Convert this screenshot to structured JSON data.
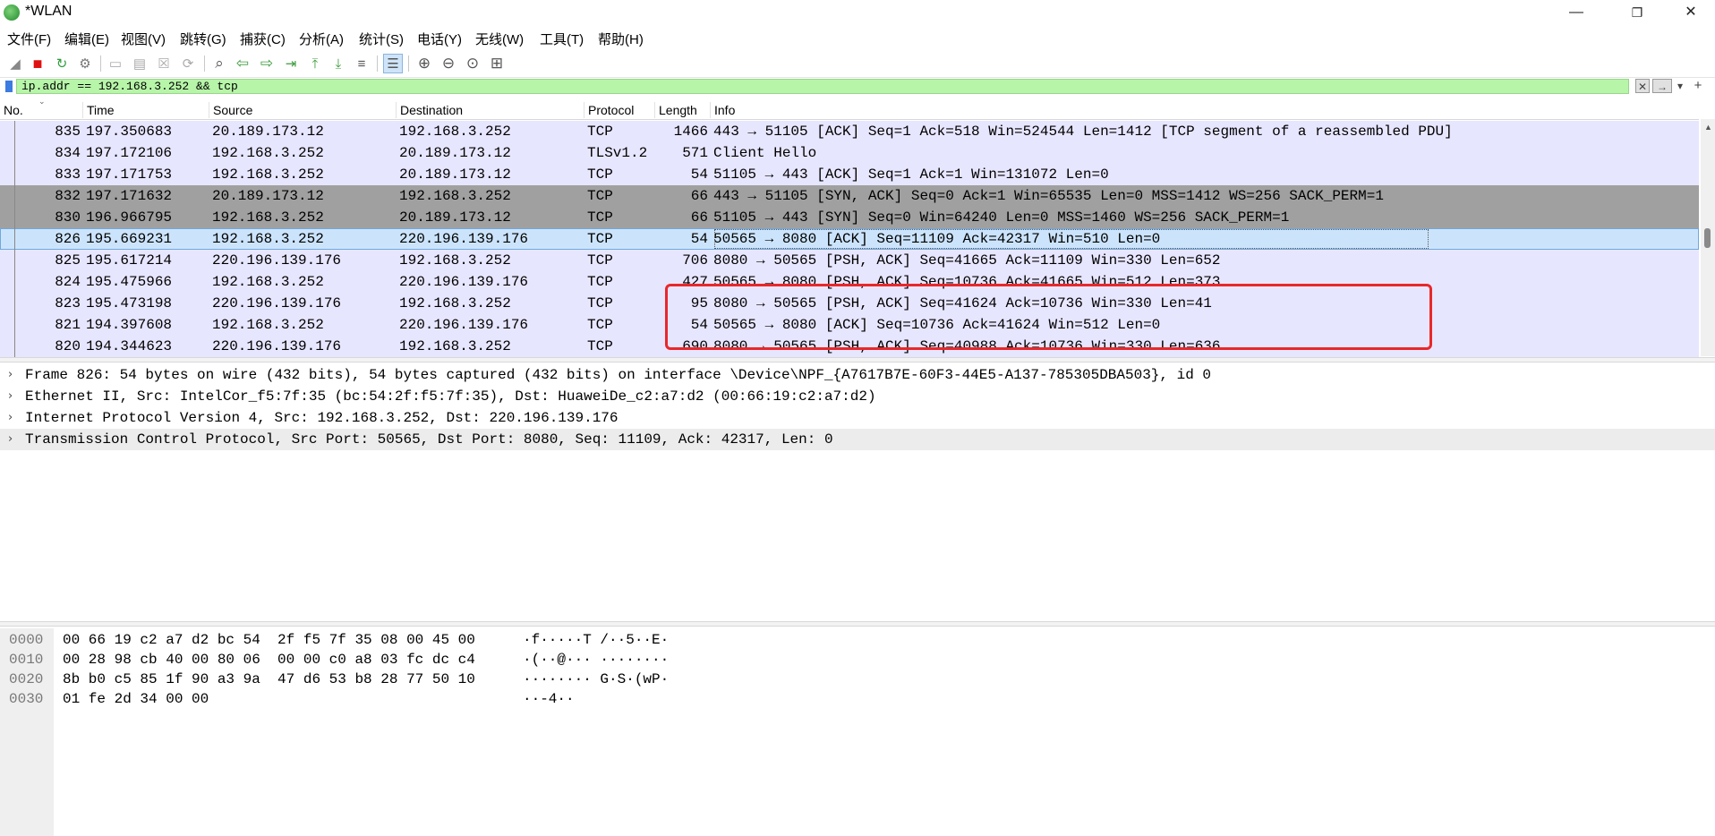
{
  "window": {
    "title": "*WLAN",
    "minimize": "—",
    "restore": "❐",
    "close": "✕"
  },
  "menu": [
    "文件(F)",
    "编辑(E)",
    "视图(V)",
    "跳转(G)",
    "捕获(C)",
    "分析(A)",
    "统计(S)",
    "电话(Y)",
    "无线(W)",
    "工具(T)",
    "帮助(H)"
  ],
  "toolbar": [
    {
      "icon": "shark-fin-start-icon",
      "glyph": "◢"
    },
    {
      "icon": "stop-capture-icon",
      "glyph": "■"
    },
    {
      "icon": "restart-capture-icon",
      "glyph": "↻"
    },
    {
      "icon": "capture-options-icon",
      "glyph": "⚙"
    },
    {
      "icon": "open-file-icon",
      "glyph": "▭"
    },
    {
      "icon": "save-file-icon",
      "glyph": "▤"
    },
    {
      "icon": "close-file-icon",
      "glyph": "☒"
    },
    {
      "icon": "reload-file-icon",
      "glyph": "⟳"
    },
    {
      "icon": "find-packet-icon",
      "glyph": "⌕"
    },
    {
      "icon": "go-back-icon",
      "glyph": "⇦"
    },
    {
      "icon": "go-forward-icon",
      "glyph": "⇨"
    },
    {
      "icon": "go-to-packet-icon",
      "glyph": "⇥"
    },
    {
      "icon": "go-first-icon",
      "glyph": "⤒"
    },
    {
      "icon": "go-last-icon",
      "glyph": "⤓"
    },
    {
      "icon": "auto-scroll-icon",
      "glyph": "≡"
    },
    {
      "icon": "colorize-icon",
      "glyph": "☰"
    },
    {
      "icon": "zoom-in-icon",
      "glyph": "⊕"
    },
    {
      "icon": "zoom-out-icon",
      "glyph": "⊖"
    },
    {
      "icon": "zoom-normal-icon",
      "glyph": "⊙"
    },
    {
      "icon": "resize-columns-icon",
      "glyph": "⊞"
    }
  ],
  "filter": {
    "value": "ip.addr == 192.168.3.252 && tcp",
    "clear_glyph": "✕",
    "apply_glyph": "→",
    "dropdown_glyph": "▾",
    "add_glyph": "+"
  },
  "columns": [
    "No.",
    "Time",
    "Source",
    "Destination",
    "Protocol",
    "Length",
    "Info"
  ],
  "packets": [
    {
      "no": "835",
      "time": "197.350683",
      "src": "20.189.173.12",
      "dst": "192.168.3.252",
      "proto": "TCP",
      "len": "1466",
      "info": "443 → 51105 [ACK] Seq=1 Ack=518 Win=524544 Len=1412 [TCP segment of a reassembled PDU]",
      "style": "normal"
    },
    {
      "no": "834",
      "time": "197.172106",
      "src": "192.168.3.252",
      "dst": "20.189.173.12",
      "proto": "TLSv1.2",
      "len": "571",
      "info": "Client Hello",
      "style": "normal"
    },
    {
      "no": "833",
      "time": "197.171753",
      "src": "192.168.3.252",
      "dst": "20.189.173.12",
      "proto": "TCP",
      "len": "54",
      "info": "51105 → 443 [ACK] Seq=1 Ack=1 Win=131072 Len=0",
      "style": "normal"
    },
    {
      "no": "832",
      "time": "197.171632",
      "src": "20.189.173.12",
      "dst": "192.168.3.252",
      "proto": "TCP",
      "len": "66",
      "info": "443 → 51105 [SYN, ACK] Seq=0 Ack=1 Win=65535 Len=0 MSS=1412 WS=256 SACK_PERM=1",
      "style": "syn"
    },
    {
      "no": "830",
      "time": "196.966795",
      "src": "192.168.3.252",
      "dst": "20.189.173.12",
      "proto": "TCP",
      "len": "66",
      "info": "51105 → 443 [SYN] Seq=0 Win=64240 Len=0 MSS=1460 WS=256 SACK_PERM=1",
      "style": "syn"
    },
    {
      "no": "826",
      "time": "195.669231",
      "src": "192.168.3.252",
      "dst": "220.196.139.176",
      "proto": "TCP",
      "len": "54",
      "info": "50565 → 8080 [ACK] Seq=11109 Ack=42317 Win=510 Len=0",
      "style": "selected"
    },
    {
      "no": "825",
      "time": "195.617214",
      "src": "220.196.139.176",
      "dst": "192.168.3.252",
      "proto": "TCP",
      "len": "706",
      "info": "8080 → 50565 [PSH, ACK] Seq=41665 Ack=11109 Win=330 Len=652",
      "style": "normal"
    },
    {
      "no": "824",
      "time": "195.475966",
      "src": "192.168.3.252",
      "dst": "220.196.139.176",
      "proto": "TCP",
      "len": "427",
      "info": "50565 → 8080 [PSH, ACK] Seq=10736 Ack=41665 Win=512 Len=373",
      "style": "normal"
    },
    {
      "no": "823",
      "time": "195.473198",
      "src": "220.196.139.176",
      "dst": "192.168.3.252",
      "proto": "TCP",
      "len": "95",
      "info": "8080 → 50565 [PSH, ACK] Seq=41624 Ack=10736 Win=330 Len=41",
      "style": "normal"
    },
    {
      "no": "821",
      "time": "194.397608",
      "src": "192.168.3.252",
      "dst": "220.196.139.176",
      "proto": "TCP",
      "len": "54",
      "info": "50565 → 8080 [ACK] Seq=10736 Ack=41624 Win=512 Len=0",
      "style": "normal"
    },
    {
      "no": "820",
      "time": "194.344623",
      "src": "220.196.139.176",
      "dst": "192.168.3.252",
      "proto": "TCP",
      "len": "690",
      "info": "8080 → 50565 [PSH, ACK] Seq=40988 Ack=10736 Win=330 Len=636",
      "style": "normal"
    }
  ],
  "details": [
    "Frame 826: 54 bytes on wire (432 bits), 54 bytes captured (432 bits) on interface \\Device\\NPF_{A7617B7E-60F3-44E5-A137-785305DBA503}, id 0",
    "Ethernet II, Src: IntelCor_f5:7f:35 (bc:54:2f:f5:7f:35), Dst: HuaweiDe_c2:a7:d2 (00:66:19:c2:a7:d2)",
    "Internet Protocol Version 4, Src: 192.168.3.252, Dst: 220.196.139.176",
    "Transmission Control Protocol, Src Port: 50565, Dst Port: 8080, Seq: 11109, Ack: 42317, Len: 0"
  ],
  "bytes": [
    {
      "offset": "0000",
      "hex": "00 66 19 c2 a7 d2 bc 54  2f f5 7f 35 08 00 45 00",
      "ascii": "·f·····T /··5··E·"
    },
    {
      "offset": "0010",
      "hex": "00 28 98 cb 40 00 80 06  00 00 c0 a8 03 fc dc c4",
      "ascii": "·(··@··· ········"
    },
    {
      "offset": "0020",
      "hex": "8b b0 c5 85 1f 90 a3 9a  47 d6 53 b8 28 77 50 10",
      "ascii": "········ G·S·(wP·"
    },
    {
      "offset": "0030",
      "hex": "01 fe 2d 34 00 00",
      "ascii": "··-4··"
    }
  ],
  "colors": {
    "row_normal": "#e7e6ff",
    "row_syn": "#a0a0a0",
    "row_selected": "#cce4fb",
    "filter_valid": "#b7f5a9",
    "annotation": "#e8282b"
  }
}
